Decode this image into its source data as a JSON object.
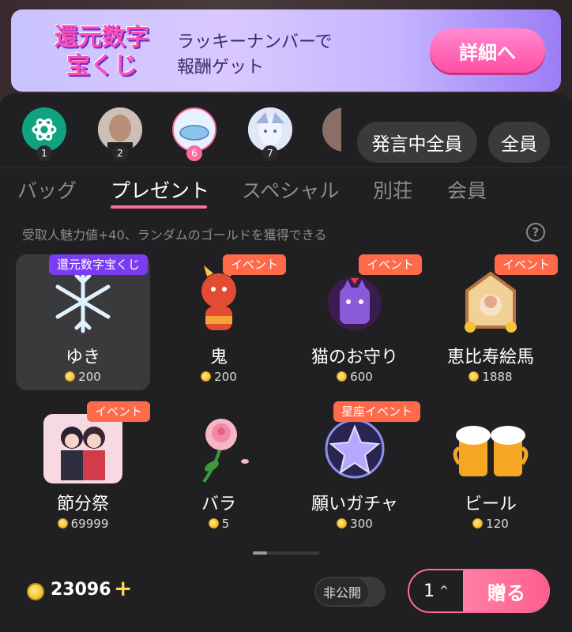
{
  "banner": {
    "logo_line1": "還元数字",
    "logo_line2": "宝くじ",
    "text_line1": "ラッキーナンバーで",
    "text_line2": "報酬ゲット",
    "button": "詳細へ"
  },
  "recipients": {
    "avatars": [
      {
        "num": "1",
        "icon": "chatgpt-logo-icon",
        "color": "#10a37f"
      },
      {
        "num": "2",
        "icon": "bald-man-avatar",
        "color": "#d8c4b6"
      },
      {
        "num": "6",
        "icon": "blue-character-avatar",
        "color": "#d9ecff"
      },
      {
        "num": "7",
        "icon": "anime-girl-avatar",
        "color": "#c9d6f0"
      }
    ],
    "all_speakers": "発言中全員",
    "all": "全員"
  },
  "tabs": [
    "バッグ",
    "プレゼント",
    "スペシャル",
    "別荘",
    "会員"
  ],
  "active_tab": "プレゼント",
  "hint": "受取人魅力値+40、ランダムのゴールドを獲得できる",
  "gifts": [
    {
      "name": "ゆき",
      "price": "200",
      "badge": "還元数字宝くじ",
      "badge_color": "#7a3cf0",
      "icon": "snowflake-icon",
      "selected": true
    },
    {
      "name": "鬼",
      "price": "200",
      "badge": "イベント",
      "badge_color": "#ff6a4a",
      "icon": "red-oni-icon"
    },
    {
      "name": "猫のお守り",
      "price": "600",
      "badge": "イベント",
      "badge_color": "#ff6a4a",
      "icon": "cat-charm-icon"
    },
    {
      "name": "恵比寿絵馬",
      "price": "1888",
      "badge": "イベント",
      "badge_color": "#ff6a4a",
      "icon": "ema-plaque-icon"
    },
    {
      "name": "節分祭",
      "price": "69999",
      "badge": "イベント",
      "badge_color": "#ff6a4a",
      "icon": "setsubun-couple-icon"
    },
    {
      "name": "バラ",
      "price": "5",
      "badge": "",
      "icon": "rose-icon"
    },
    {
      "name": "願いガチャ",
      "price": "300",
      "badge": "星座イベント",
      "badge_color": "#ff6a4a",
      "icon": "star-orb-icon"
    },
    {
      "name": "ビール",
      "price": "120",
      "badge": "",
      "icon": "beer-mugs-icon"
    }
  ],
  "footer": {
    "balance": "23096",
    "plus": "+",
    "privacy": "非公開",
    "quantity": "1",
    "send": "贈る"
  }
}
